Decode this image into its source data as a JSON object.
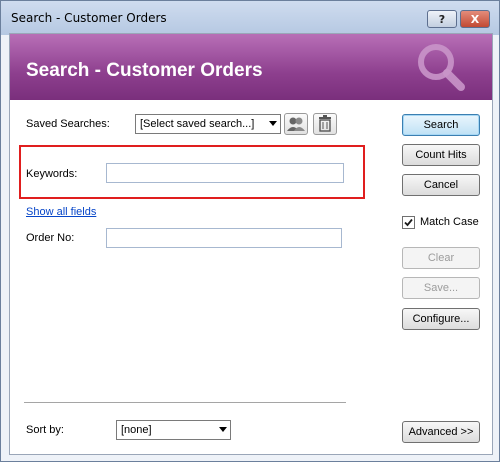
{
  "window": {
    "title": "Search - Customer Orders",
    "help_label": "?",
    "close_label": "X"
  },
  "banner": {
    "title": "Search - Customer Orders",
    "icon": "magnifier-icon",
    "color": "#8d3f8e"
  },
  "saved_searches": {
    "label": "Saved Searches:",
    "selected": "[Select saved search...]",
    "manage_icon": "users-icon",
    "delete_icon": "trash-icon"
  },
  "fields": {
    "keywords_label": "Keywords:",
    "keywords_value": "",
    "show_all_fields": "Show all fields",
    "order_no_label": "Order No:",
    "order_no_value": ""
  },
  "buttons": {
    "search": "Search",
    "count_hits": "Count Hits",
    "cancel": "Cancel",
    "clear": "Clear",
    "save": "Save...",
    "configure": "Configure...",
    "advanced": "Advanced >>"
  },
  "options": {
    "match_case_label": "Match Case",
    "match_case_checked": true
  },
  "sort": {
    "label": "Sort by:",
    "selected": "[none]"
  },
  "highlight_color": "#e01e1e"
}
